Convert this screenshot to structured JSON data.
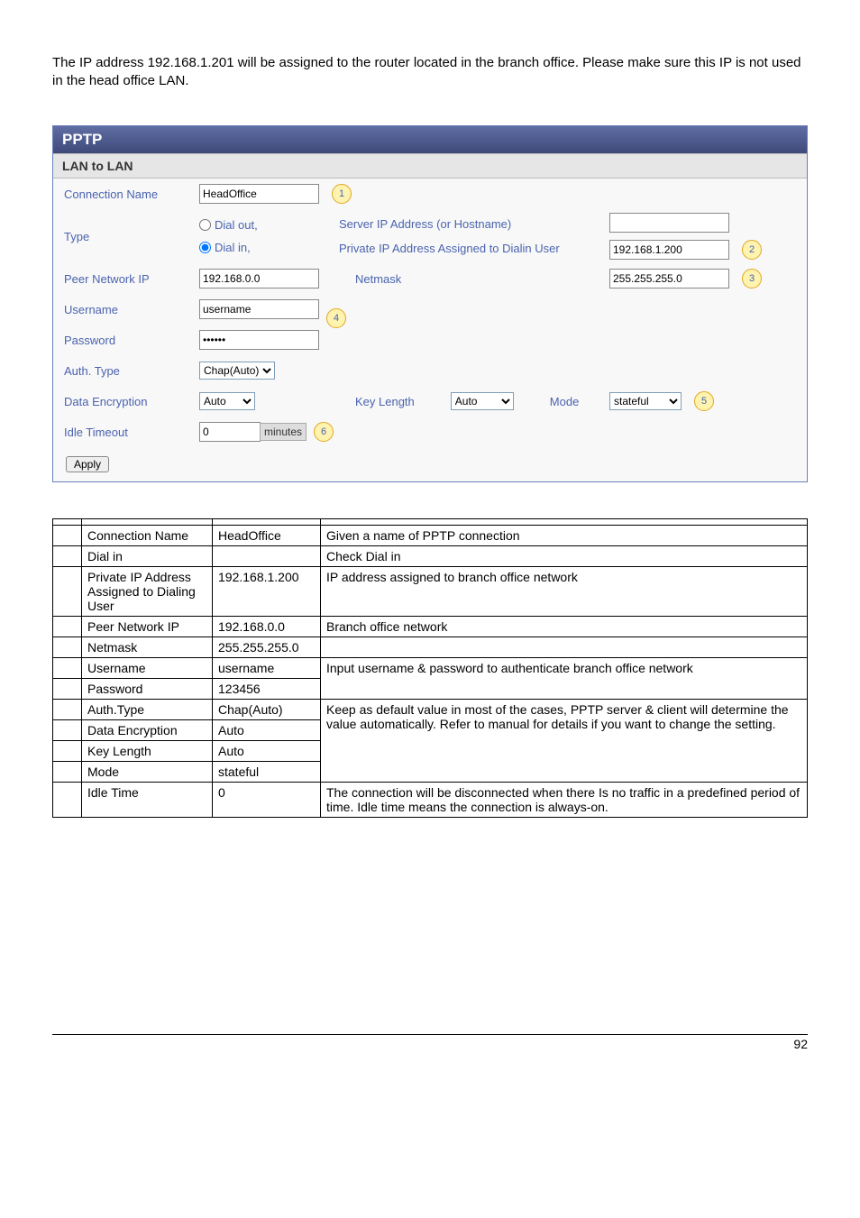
{
  "intro": "The IP address 192.168.1.201 will be assigned to the router located in the branch office. Please make sure this IP is not used in the head office LAN.",
  "panel": {
    "title": "PPTP",
    "subtitle": "LAN to LAN",
    "labels": {
      "connection_name": "Connection Name",
      "type": "Type",
      "dial_out": "Dial out,",
      "dial_in": "Dial in,",
      "server_ip": "Server IP Address (or Hostname)",
      "private_ip": "Private IP Address Assigned to Dialin User",
      "peer_network": "Peer Network IP",
      "netmask": "Netmask",
      "username": "Username",
      "password": "Password",
      "auth_type": "Auth. Type",
      "data_encryption": "Data Encryption",
      "key_length": "Key Length",
      "mode": "Mode",
      "idle_timeout": "Idle Timeout",
      "minutes": "minutes",
      "apply": "Apply"
    },
    "values": {
      "connection_name": "HeadOffice",
      "server_ip": "",
      "private_ip": "192.168.1.200",
      "peer_network": "192.168.0.0",
      "netmask": "255.255.255.0",
      "username": "username",
      "password": "••••••",
      "auth_type": "Chap(Auto)",
      "data_encryption": "Auto",
      "key_length": "Auto",
      "mode": "stateful",
      "idle_timeout": "0"
    },
    "callouts": {
      "c1": "1",
      "c2": "2",
      "c3": "3",
      "c4": "4",
      "c5": "5",
      "c6": "6"
    }
  },
  "table": {
    "rows": [
      {
        "item": "",
        "name": "",
        "value": "",
        "desc": ""
      },
      {
        "item": "",
        "name": "Connection Name",
        "value": "HeadOffice",
        "desc": "Given a name of PPTP connection"
      },
      {
        "item": "",
        "name": "Dial in",
        "value": "",
        "desc": "Check Dial in"
      },
      {
        "item": "",
        "name": "Private IP Address Assigned to Dialing User",
        "value": "192.168.1.200",
        "desc": "IP address assigned to branch office network"
      },
      {
        "item": "",
        "name": "Peer Network IP",
        "value": "192.168.0.0",
        "desc": "Branch office network"
      },
      {
        "item": "",
        "name": "Netmask",
        "value": "255.255.255.0",
        "desc": ""
      },
      {
        "item": "",
        "name": "Username",
        "value": "username",
        "desc_merge_start": true,
        "desc": "Input username & password to authenticate branch office network"
      },
      {
        "item": "",
        "name": "Password",
        "value": "123456"
      },
      {
        "item": "",
        "name": "Auth.Type",
        "value": "Chap(Auto)",
        "desc_merge_start4": true,
        "desc": "Keep as default value in most of the cases, PPTP server & client will determine the value automatically. Refer to manual for details if you want to change the setting."
      },
      {
        "item": "",
        "name": "Data Encryption",
        "value": "Auto"
      },
      {
        "item": "",
        "name": "Key Length",
        "value": "Auto"
      },
      {
        "item": "",
        "name": "Mode",
        "value": "stateful"
      },
      {
        "item": "",
        "name": "Idle Time",
        "value": "0",
        "desc": "The connection will be disconnected when there Is no traffic in a predefined period of time.  Idle time    means the connection is always-on."
      }
    ]
  },
  "page_number": "92"
}
